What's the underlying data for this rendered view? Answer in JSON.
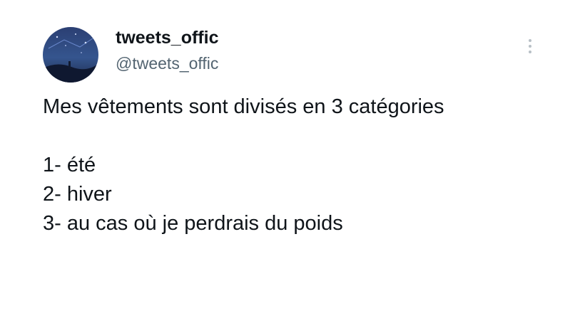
{
  "author": {
    "display_name": "tweets_offic",
    "handle": "@tweets_offic",
    "avatar_icon": "night-sky-avatar"
  },
  "menu": {
    "icon": "more-vertical-icon"
  },
  "tweet": {
    "intro": "Mes vêtements sont divisés en 3 catégories",
    "lines": [
      "1- été",
      "2- hiver",
      "3- au cas où je perdrais du poids"
    ]
  },
  "colors": {
    "text": "#0f1419",
    "secondary": "#536471",
    "background": "#ffffff"
  }
}
